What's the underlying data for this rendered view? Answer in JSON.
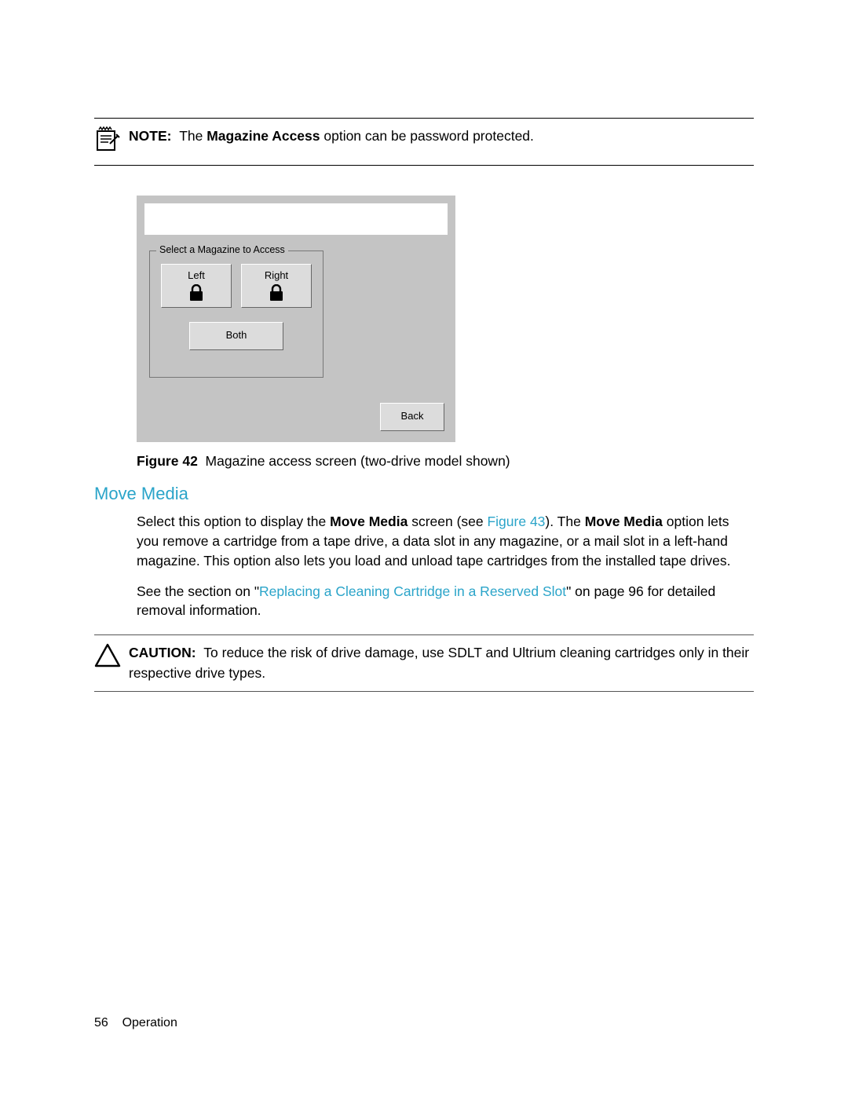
{
  "note": {
    "prefix": "NOTE:",
    "text_before": "The ",
    "bold_term": "Magazine Access",
    "text_after": " option can be password protected."
  },
  "panel": {
    "group_label": "Select a Magazine to Access",
    "left_label": "Left",
    "right_label": "Right",
    "both_label": "Both",
    "back_label": "Back"
  },
  "figure": {
    "label": "Figure 42",
    "caption": "Magazine access screen (two-drive model shown)"
  },
  "heading": "Move Media",
  "para1": {
    "t1": "Select this option to display the ",
    "b1": "Move Media",
    "t2": " screen (see ",
    "link": "Figure 43",
    "t3": "). The ",
    "b2": "Move Media",
    "t4": " option lets you remove a cartridge from a tape drive, a data slot in any magazine, or a mail slot in a left-hand magazine. This option also lets you load and unload tape cartridges from the installed tape drives."
  },
  "para2": {
    "t1": "See the section on \"",
    "link": "Replacing a Cleaning Cartridge in a Reserved Slot",
    "t2": "\" on page 96 for detailed removal information."
  },
  "caution": {
    "prefix": "CAUTION:",
    "text": "To reduce the risk of drive damage, use SDLT and Ultrium cleaning cartridges only in their respective drive types."
  },
  "footer": {
    "page": "56",
    "section": "Operation"
  }
}
